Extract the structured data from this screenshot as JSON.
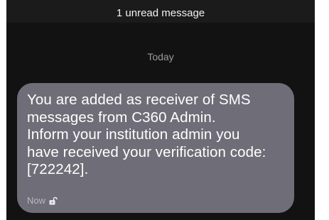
{
  "banner": {
    "unread_text": "1 unread message"
  },
  "conversation": {
    "date_divider": "Today",
    "messages": [
      {
        "body": "You are added as receiver of SMS\nmessages from C360 Admin.\nInform your institution admin you\nhave received your verification code:\n[722242].",
        "time": "Now",
        "status_icon": "unlocked-lock-icon"
      }
    ]
  },
  "colors": {
    "background": "#121212",
    "bubble": "#6f6e78",
    "text": "#ffffff",
    "muted": "#9a9a9a"
  }
}
